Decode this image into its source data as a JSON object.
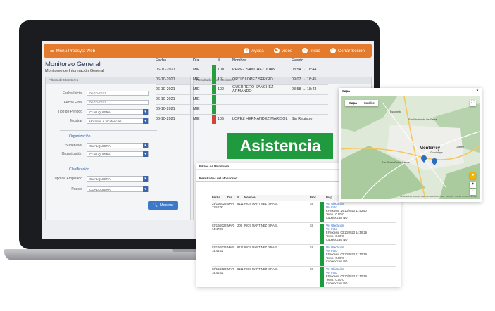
{
  "banner": {
    "text": "Asistencia",
    "color": "#1f9a3f"
  },
  "topbar": {
    "menu_label": "Menú Preasyst Web",
    "items": [
      {
        "label": "Ayuda",
        "icon": "help-icon"
      },
      {
        "label": "Video",
        "icon": "video-icon"
      },
      {
        "label": "Inicio",
        "icon": "home-icon"
      },
      {
        "label": "Cerrar Sesión",
        "icon": "logout-icon"
      }
    ],
    "accent": "#e37a2c"
  },
  "page": {
    "title": "Monitoreo General",
    "subtitle": "Monitoreo de Información General"
  },
  "filters": {
    "title": "Filtros de Monitoreo",
    "fecha_inicial": {
      "label": "Fecha Inicial",
      "value": "06-10-2021"
    },
    "fecha_final": {
      "label": "Fecha Final",
      "value": "06-10-2021"
    },
    "tipo_periodo": {
      "label": "Tipo de Periodo",
      "value": "CUALQUIERA"
    },
    "mostrar": {
      "label": "Mostrar",
      "value": "Horarios e Incidencias"
    },
    "org_section": "Organización",
    "supervisor": {
      "label": "Supervisor",
      "value": "CUALQUIERA"
    },
    "organizacion": {
      "label": "Organización",
      "value": "CUALQUIERA"
    },
    "class_section": "Clasificación",
    "tipo_empleado": {
      "label": "Tipo de Empleado",
      "value": "CUALQUIERA"
    },
    "puesto": {
      "label": "Puesto",
      "value": "CUALQUIERA"
    },
    "button": "Mostrar"
  },
  "results": {
    "title": "Resultados del Monitoreo",
    "headers": [
      "Fecha",
      "Día",
      "#",
      "Nombre",
      "Evento"
    ],
    "rows": [
      {
        "fecha": "06-10-2021",
        "dia": "MIE",
        "num": "100",
        "nombre": "PEREZ SANCHEZ JUAN",
        "evento": "08:54 → 18:44",
        "color": "#2a9d3f"
      },
      {
        "fecha": "06-10-2021",
        "dia": "MIE",
        "num": "101",
        "nombre": "ORTIZ LOPEZ SERGIO",
        "evento": "09:07 → 18:45",
        "color": "#2a9d3f"
      },
      {
        "fecha": "06-10-2021",
        "dia": "MIE",
        "num": "102",
        "nombre": "GUERRERO SANCHEZ ARMANDO",
        "evento": "08:58 → 18:43",
        "color": "#2a9d3f"
      },
      {
        "fecha": "06-10-2021",
        "dia": "MIE",
        "num": "",
        "nombre": "",
        "evento": "",
        "color": "#2a9d3f"
      },
      {
        "fecha": "06-10-2021",
        "dia": "MIE",
        "num": "",
        "nombre": "",
        "evento": "",
        "color": "#2a9d3f"
      },
      {
        "fecha": "06-10-2021",
        "dia": "MIE",
        "num": "105",
        "nombre": "LOPEZ HERNANDEZ MARISOL",
        "evento": "Sin Registro",
        "color": "#d0453a"
      }
    ]
  },
  "card": {
    "filters_title": "Filtros de Monitoreo",
    "results_title": "Resultados del Monitoreo",
    "headers": [
      "Fecha",
      "Día",
      "#",
      "Nombre",
      "Proc.",
      "",
      "Disp."
    ],
    "rows": [
      {
        "fecha": "24/10/2023 11:53:00",
        "dia": "MAR",
        "num": "8111",
        "nombre": "RIOS MARTINEZ ISRAEL",
        "proc": "SI",
        "l1": "Ver Ubicación",
        "l2": "Ver Foto",
        "d1": "F.Proceso: 24/10/2023 11:53:50",
        "d2": "Temp.: 0.00°C",
        "d3": "Cubrebocas: NO"
      },
      {
        "fecha": "03/10/2023 14:47:37",
        "dia": "MAR",
        "num": "205",
        "nombre": "RIOS MARTINEZ ISRAEL",
        "proc": "SI",
        "l1": "Ver Ubicación",
        "l2": "Ver Foto",
        "d1": "F.Proceso: 03/10/2023 14:58:26",
        "d2": "Temp.: 0.00°C",
        "d3": "Cubrebocas: NO"
      },
      {
        "fecha": "03/10/2023 14:46:32",
        "dia": "MAR",
        "num": "8111",
        "nombre": "RIOS MARTINEZ ISRAEL",
        "proc": "SI",
        "l1": "Ver Ubicación",
        "l2": "Ver Foto",
        "d1": "F.Proceso: 03/10/2023 11:10:39",
        "d2": "Temp.: 0.00°C",
        "d3": "Cubrebocas: NO"
      },
      {
        "fecha": "03/10/2023 14:40:32",
        "dia": "MAR",
        "num": "8111",
        "nombre": "RIOS MARTINEZ ISRAEL",
        "proc": "SI",
        "l1": "Ver Ubicación",
        "l2": "Ver Foto",
        "d1": "F.Proceso: 03/10/2023 11:10:39",
        "d2": "Temp.: 0.00°C",
        "d3": "Cubrebocas: NO"
      }
    ]
  },
  "map": {
    "title": "Mapa",
    "tab_map": "Mapa",
    "tab_sat": "Satélite",
    "city": "Monterrey",
    "labels": [
      "San Nicolás de los Garza",
      "Escobedo",
      "San Pedro Garza García",
      "Guadalupe",
      "Juárez"
    ],
    "footer": "Combinaciones de teclas · Datos del mapa ©2023 INEGI · Términos · Informar un error en el mapa"
  }
}
